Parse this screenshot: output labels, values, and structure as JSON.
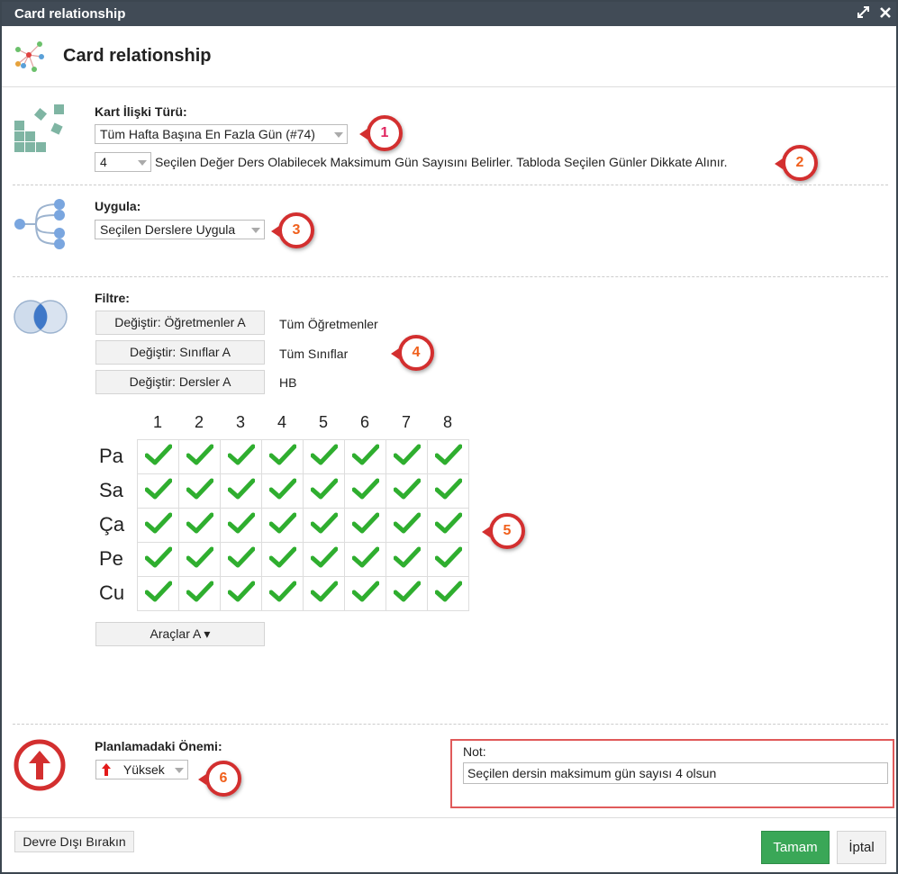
{
  "window": {
    "title": "Card relationship",
    "dialog_title": "Card relationship"
  },
  "relation": {
    "label": "Kart İlişki Türü:",
    "type_value": "Tüm Hafta Başına En Fazla Gün (#74)",
    "number_value": "4",
    "description": "Seçilen Değer Ders Olabilecek Maksimum Gün Sayısını Belirler. Tabloda Seçilen Günler Dikkate Alınır."
  },
  "apply": {
    "label": "Uygula:",
    "value": "Seçilen Derslere Uygula"
  },
  "filter": {
    "label": "Filtre:",
    "rows": [
      {
        "button": "Değiştir: Öğretmenler A",
        "value": "Tüm Öğretmenler"
      },
      {
        "button": "Değiştir: Sınıflar A",
        "value": "Tüm Sınıflar"
      },
      {
        "button": "Değiştir: Dersler A",
        "value": "HB"
      }
    ]
  },
  "grid": {
    "columns": [
      "1",
      "2",
      "3",
      "4",
      "5",
      "6",
      "7",
      "8"
    ],
    "rows": [
      "Pa",
      "Sa",
      "Ça",
      "Pe",
      "Cu"
    ]
  },
  "tools_button": "Araçlar A ▾",
  "importance": {
    "label": "Planlamadaki Önemi:",
    "value": "Yüksek"
  },
  "note": {
    "label": "Not:",
    "value": "Seçilen dersin maksimum gün sayısı 4 olsun"
  },
  "footer": {
    "disable_button": "Devre Dışı Bırakın",
    "ok_button": "Tamam",
    "cancel_button": "İptal"
  },
  "badges": [
    "1",
    "2",
    "3",
    "4",
    "5",
    "6"
  ],
  "colors": {
    "accent_red": "#d32f2f",
    "ok_green": "#3aa757",
    "check_green": "#2fae2f",
    "titlebar": "#414b56"
  }
}
